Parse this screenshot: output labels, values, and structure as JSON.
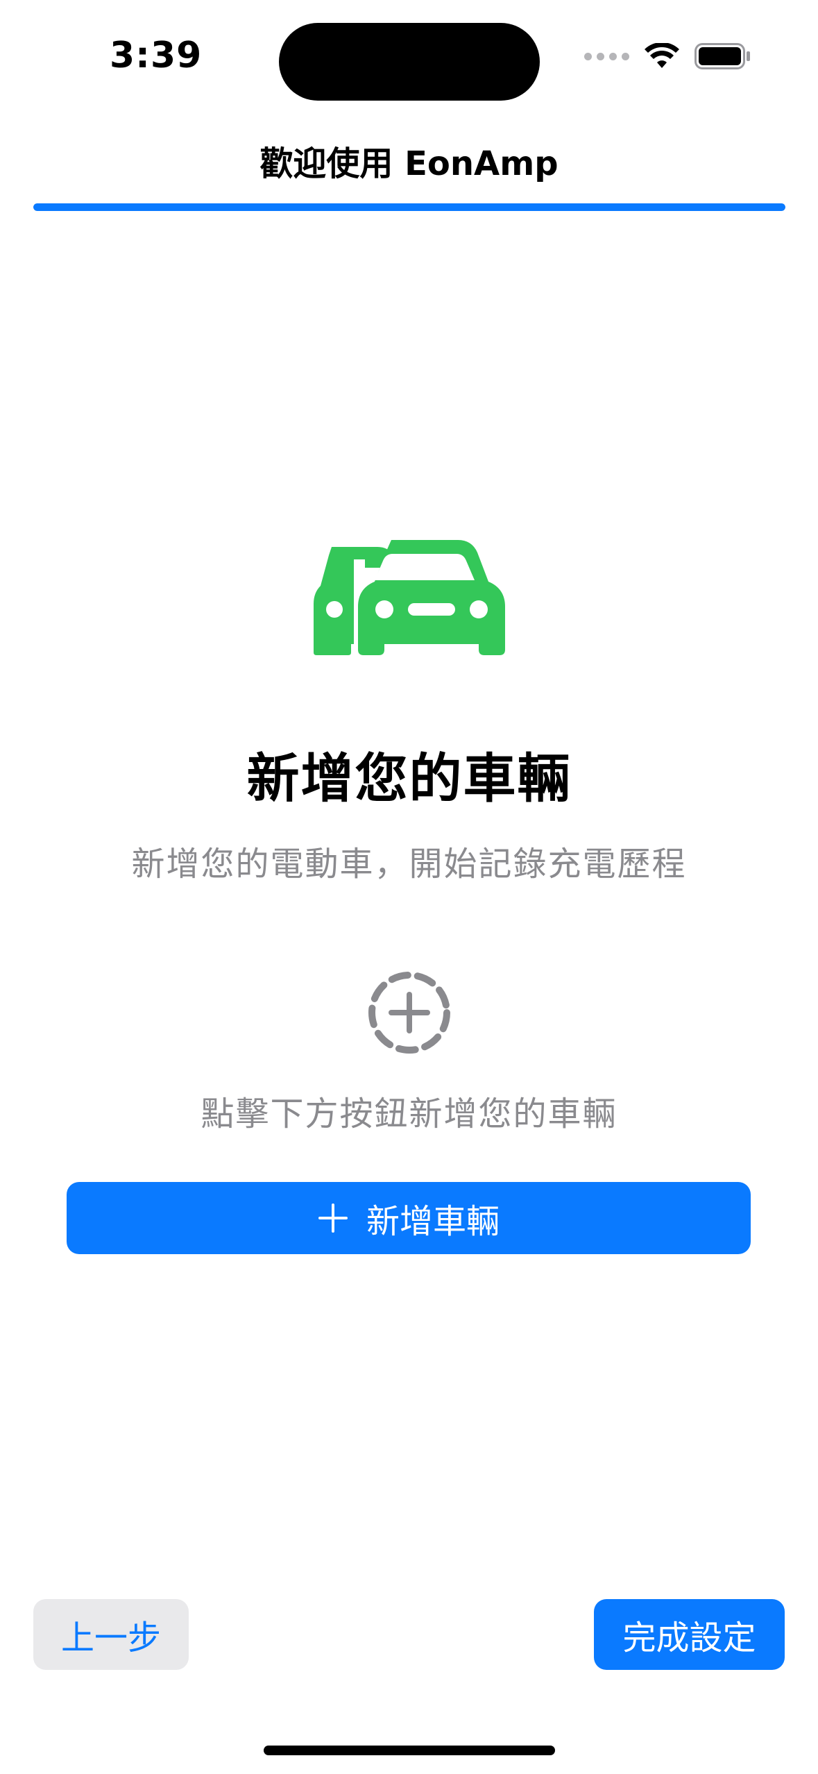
{
  "status_bar": {
    "time": "3:39",
    "icons": [
      "signal-dots-icon",
      "wifi-icon",
      "battery-icon"
    ]
  },
  "header": {
    "title": "歡迎使用 EonAmp",
    "progress": 1.0
  },
  "main": {
    "hero_icon": "two-cars-icon",
    "heading": "新增您的車輛",
    "subtitle": "新增您的電動車，開始記錄充電歷程",
    "placeholder_icon": "dashed-plus-circle-icon",
    "hint": "點擊下方按鈕新增您的車輛",
    "add_button": {
      "icon": "plus-icon",
      "label": "新增車輛"
    }
  },
  "footer": {
    "back_label": "上一步",
    "finish_label": "完成設定"
  },
  "colors": {
    "accent": "#0a7aff",
    "car_green": "#34c759",
    "secondary_text": "#8a8a8e",
    "back_button_bg": "#e9e9eb"
  }
}
